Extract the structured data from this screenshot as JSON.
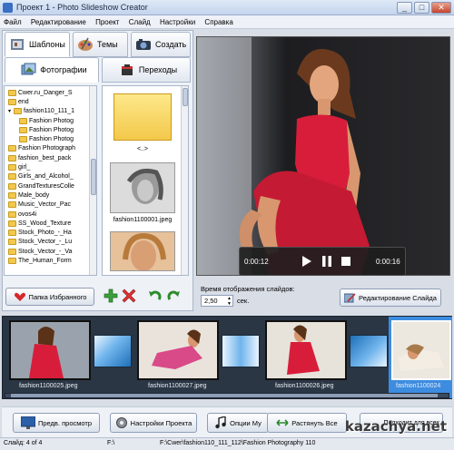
{
  "window": {
    "title": "Проект 1 - Photo Slideshow Creator",
    "controls": {
      "minimize": "_",
      "maximize": "□",
      "close": "✕"
    }
  },
  "menu": [
    "Файл",
    "Редактирование",
    "Проект",
    "Слайд",
    "Настройки",
    "Справка"
  ],
  "top_tabs": [
    {
      "label": "Шаблоны",
      "icon": "template-icon"
    },
    {
      "label": "Темы",
      "icon": "palette-icon"
    },
    {
      "label": "Создать",
      "icon": "camera-icon"
    }
  ],
  "sub_tabs": [
    {
      "label": "Фотографии",
      "icon": "photos-icon",
      "active": true
    },
    {
      "label": "Переходы",
      "icon": "transitions-icon",
      "active": false
    }
  ],
  "folders": [
    "Cwer.ru_Danger_S",
    "end",
    "fashion110_111_1",
    "Fashion Photog",
    "Fashion Photog",
    "Fashion Photog",
    "Fashion Photograph",
    "fashion_best_pack",
    "girl_",
    "Girls_and_Alcohol_",
    "GrandTexturesColle",
    "Male_body",
    "Music_Vector_Pac",
    "ovos4i",
    "SS_Wood_Texture",
    "Stock_Photo_-_Ha",
    "Stock_Vector_-_Lu",
    "Stock_Vector_-_Va",
    "The_Human_Form"
  ],
  "thumbs": {
    "up_label": "<..>",
    "items": [
      {
        "name": "fashion1100001.jpeg"
      }
    ]
  },
  "favorites_button": "Папка Избранного",
  "player": {
    "time_current": "0:00:12",
    "time_total": "0:00:16"
  },
  "slide_time": {
    "label": "Время отображения слайдов:",
    "value": "2,50",
    "unit": "сек."
  },
  "edit_slide_button": "Редактирование Слайда",
  "slides": [
    {
      "caption": "fashion1100025.jpeg"
    },
    {
      "caption": "fashion1100027.jpeg"
    },
    {
      "caption": "fashion1100026.jpeg"
    },
    {
      "caption": "fashion1100024"
    }
  ],
  "bottom_buttons": [
    {
      "label": "Предв. просмотр"
    },
    {
      "label": "Настройки Проекта"
    },
    {
      "label": "Опции Му"
    },
    {
      "label": "Растянуть Все"
    },
    {
      "label": "Подходит для всех"
    }
  ],
  "status": {
    "slide": "Слайд: 4 of 4",
    "drive": "F:\\",
    "path": "F:\\Cwer\\fashion110_111_112\\Fashion Photography 110"
  },
  "watermark": "kazachya.net",
  "colors": {
    "accent": "#3a6fc4",
    "filmstrip_bg": "#2b3645",
    "selection": "#3d8ce0",
    "dress_red": "#d81d3a"
  }
}
